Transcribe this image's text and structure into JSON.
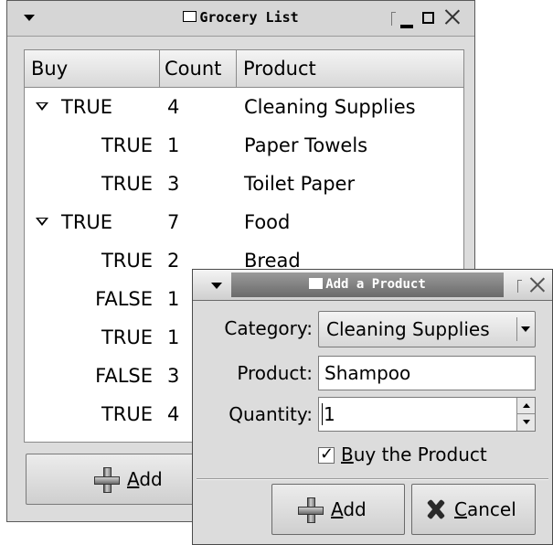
{
  "main_window": {
    "title": "Grocery List",
    "columns": [
      "Buy",
      "Count",
      "Product"
    ],
    "rows": [
      {
        "level": 0,
        "expanded": true,
        "buy": "TRUE",
        "count": "4",
        "product": "Cleaning Supplies"
      },
      {
        "level": 1,
        "buy": "TRUE",
        "count": "1",
        "product": "Paper Towels"
      },
      {
        "level": 1,
        "buy": "TRUE",
        "count": "3",
        "product": "Toilet Paper"
      },
      {
        "level": 0,
        "expanded": true,
        "buy": "TRUE",
        "count": "7",
        "product": "Food"
      },
      {
        "level": 1,
        "buy": "TRUE",
        "count": "2",
        "product": "Bread"
      },
      {
        "level": 1,
        "buy": "FALSE",
        "count": "1",
        "product": ""
      },
      {
        "level": 1,
        "buy": "TRUE",
        "count": "1",
        "product": ""
      },
      {
        "level": 1,
        "buy": "FALSE",
        "count": "3",
        "product": ""
      },
      {
        "level": 1,
        "buy": "TRUE",
        "count": "4",
        "product": ""
      }
    ],
    "add_button": {
      "mnemonic": "A",
      "rest": "dd"
    }
  },
  "dialog": {
    "title": "Add a Product",
    "category_label": "Category:",
    "category_value": "Cleaning Supplies",
    "product_label": "Product:",
    "product_value": "Shampoo",
    "quantity_label": "Quantity:",
    "quantity_value": "1",
    "checkbox": {
      "checked": true,
      "mnemonic": "B",
      "rest": "uy the Product"
    },
    "add_button": {
      "mnemonic": "A",
      "rest": "dd"
    },
    "cancel_button": {
      "mnemonic": "C",
      "rest": "ancel"
    }
  }
}
